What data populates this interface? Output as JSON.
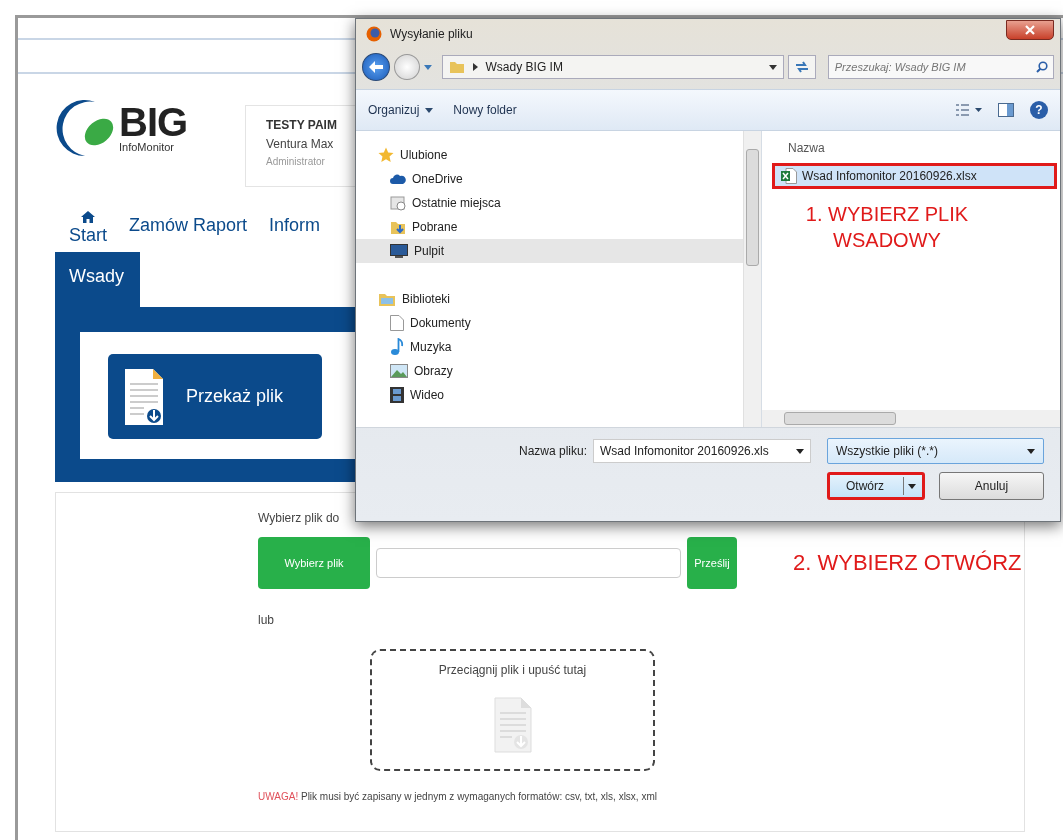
{
  "page": {
    "logo": {
      "name": "BIG",
      "subtitle": "InfoMonitor"
    },
    "user_card": {
      "company": "TESTY PAIM",
      "user": "Ventura Max",
      "role": "Administrator"
    },
    "nav": [
      {
        "label": "Start",
        "kind": "home"
      },
      {
        "label": "Zamów Raport",
        "kind": "text"
      },
      {
        "label": "Inform",
        "kind": "text"
      }
    ],
    "tabs": [
      {
        "label": "Wsady",
        "selected": true
      }
    ],
    "upload_tile": {
      "label": "Przekaż plik"
    },
    "upload_form": {
      "prompt": "Wybierz plik do",
      "choose_button": "Wybierz plik",
      "send_button": "Prześlij",
      "annotation": "2. WYBIERZ OTWÓRZ",
      "or_label": "lub",
      "drop_zone": "Przeciągnij plik i upuść tutaj",
      "warning": {
        "label": "UWAGA!",
        "text": "Plik musi być zapisany w jednym z wymaganych formatów: csv, txt, xls, xlsx, xml"
      }
    }
  },
  "dialog": {
    "title": "Wysyłanie pliku",
    "path": "Wsady BIG IM",
    "search": {
      "placeholder": "Przeszukaj: Wsady BIG IM"
    },
    "toolbar": [
      {
        "label": "Organizuj",
        "kind": "menu"
      },
      {
        "label": "Nowy folder",
        "kind": "button"
      }
    ],
    "help": "?",
    "nav_tree": [
      {
        "label": "Ulubione",
        "kind": "star",
        "selected": false,
        "children": [
          {
            "label": "OneDrive",
            "kind": "cloud",
            "selected": false
          },
          {
            "label": "Ostatnie miejsca",
            "kind": "recent",
            "selected": false
          },
          {
            "label": "Pobrane",
            "kind": "download",
            "selected": false
          },
          {
            "label": "Pulpit",
            "kind": "desktop",
            "selected": true
          }
        ]
      },
      {
        "label": "Biblioteki",
        "kind": "library",
        "selected": false,
        "children": [
          {
            "label": "Dokumenty",
            "kind": "document",
            "selected": false
          },
          {
            "label": "Muzyka",
            "kind": "music",
            "selected": false
          },
          {
            "label": "Obrazy",
            "kind": "picture",
            "selected": false
          },
          {
            "label": "Wideo",
            "kind": "video",
            "selected": false
          }
        ]
      }
    ],
    "file_list": {
      "column": "Nazwa",
      "files": [
        {
          "name": "Wsad Infomonitor 20160926.xlsx",
          "selected": true,
          "highlighted": true
        }
      ],
      "annotation": "1. WYBIERZ PLIK WSADOWY"
    },
    "filename": {
      "label": "Nazwa pliku:",
      "value": "Wsad Infomonitor 20160926.xls"
    },
    "filter": {
      "value": "Wszystkie pliki (*.*)"
    },
    "buttons": [
      {
        "label": "Otwórz",
        "kind": "split",
        "highlighted": true
      },
      {
        "label": "Anuluj",
        "kind": "plain",
        "highlighted": false
      }
    ]
  }
}
